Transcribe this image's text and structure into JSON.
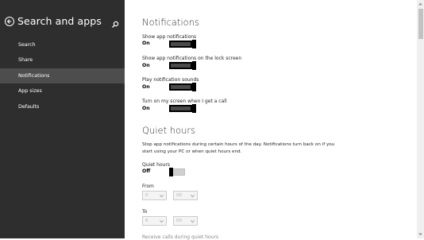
{
  "sidebar": {
    "title": "Search and apps",
    "items": [
      {
        "label": "Search"
      },
      {
        "label": "Share"
      },
      {
        "label": "Notifications",
        "active": true
      },
      {
        "label": "App sizes"
      },
      {
        "label": "Defaults"
      }
    ]
  },
  "notifications": {
    "heading": "Notifications",
    "settings": [
      {
        "label": "Show app notifications",
        "value": "On"
      },
      {
        "label": "Show app notifications on the lock screen",
        "value": "On"
      },
      {
        "label": "Play notification sounds",
        "value": "On"
      },
      {
        "label": "Turn on my screen when I get a call",
        "value": "On"
      }
    ]
  },
  "quiet_hours": {
    "heading": "Quiet hours",
    "description": "Stop app notifications during certain hours of the day. Notifications turn back on if you start using your PC or when quiet hours end.",
    "toggle_label": "Quiet hours",
    "toggle_value": "Off",
    "from_label": "From",
    "from_hour": "0",
    "from_minute": "00",
    "to_label": "To",
    "to_hour": "6",
    "to_minute": "00",
    "receive_calls_label": "Receive calls during quiet hours"
  },
  "colors": {
    "sidebar_bg": "#2e2e2e",
    "sidebar_active": "#4d4d4d",
    "toggle_on": "#000000"
  }
}
